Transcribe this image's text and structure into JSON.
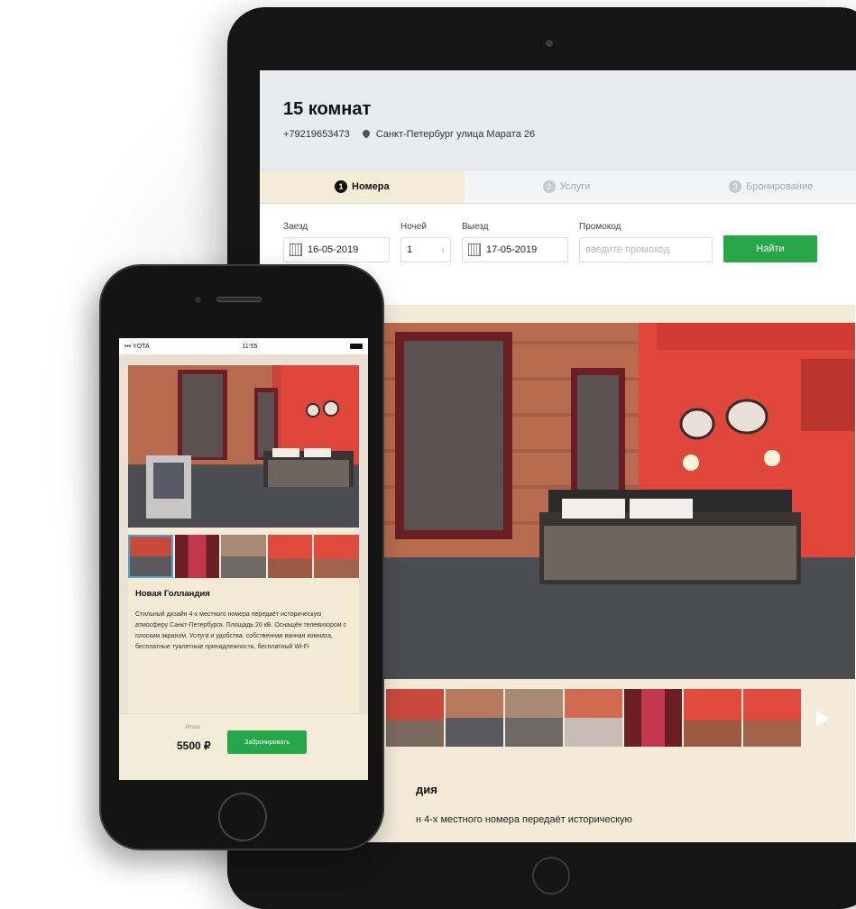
{
  "tablet": {
    "title": "15 комнат",
    "phone": "+79219653473",
    "address": "Санкт-Петербург улица Марата 26",
    "steps": [
      {
        "num": "1",
        "label": "Номера"
      },
      {
        "num": "2",
        "label": "Услуги"
      },
      {
        "num": "3",
        "label": "Бронирование"
      }
    ],
    "form": {
      "checkin_label": "Заезд",
      "checkin_value": "16-05-2019",
      "nights_label": "Ночей",
      "nights_value": "1",
      "checkout_label": "Выезд",
      "checkout_value": "17-05-2019",
      "promo_label": "Промокод",
      "promo_placeholder": "введите промокод",
      "find_label": "Найти"
    },
    "room_name_fragment": "дия",
    "room_desc_fragment": "н 4-х местного номера передаёт историческую"
  },
  "phone": {
    "carrier": "YOTA",
    "time": "11:55",
    "room_name": "Новая Голландия",
    "room_desc": "Стильный дизайн 4-х местного номера передаёт историческую атмосферу Санкт-Петербурга. Площадь 20 кВ. Оснащён телевизором с плоским экраном. Услуги и удобства: собственная ванная комната, бесплатные туалетные принадлежности, бесплатный Wi-Fi",
    "total_label": "Итого",
    "price": "5500 ₽",
    "book_label": "Забронировать"
  },
  "colors": {
    "accent_green": "#27a74a",
    "active_step_bg": "#f4ecd5",
    "room_red": "#e0463a"
  }
}
